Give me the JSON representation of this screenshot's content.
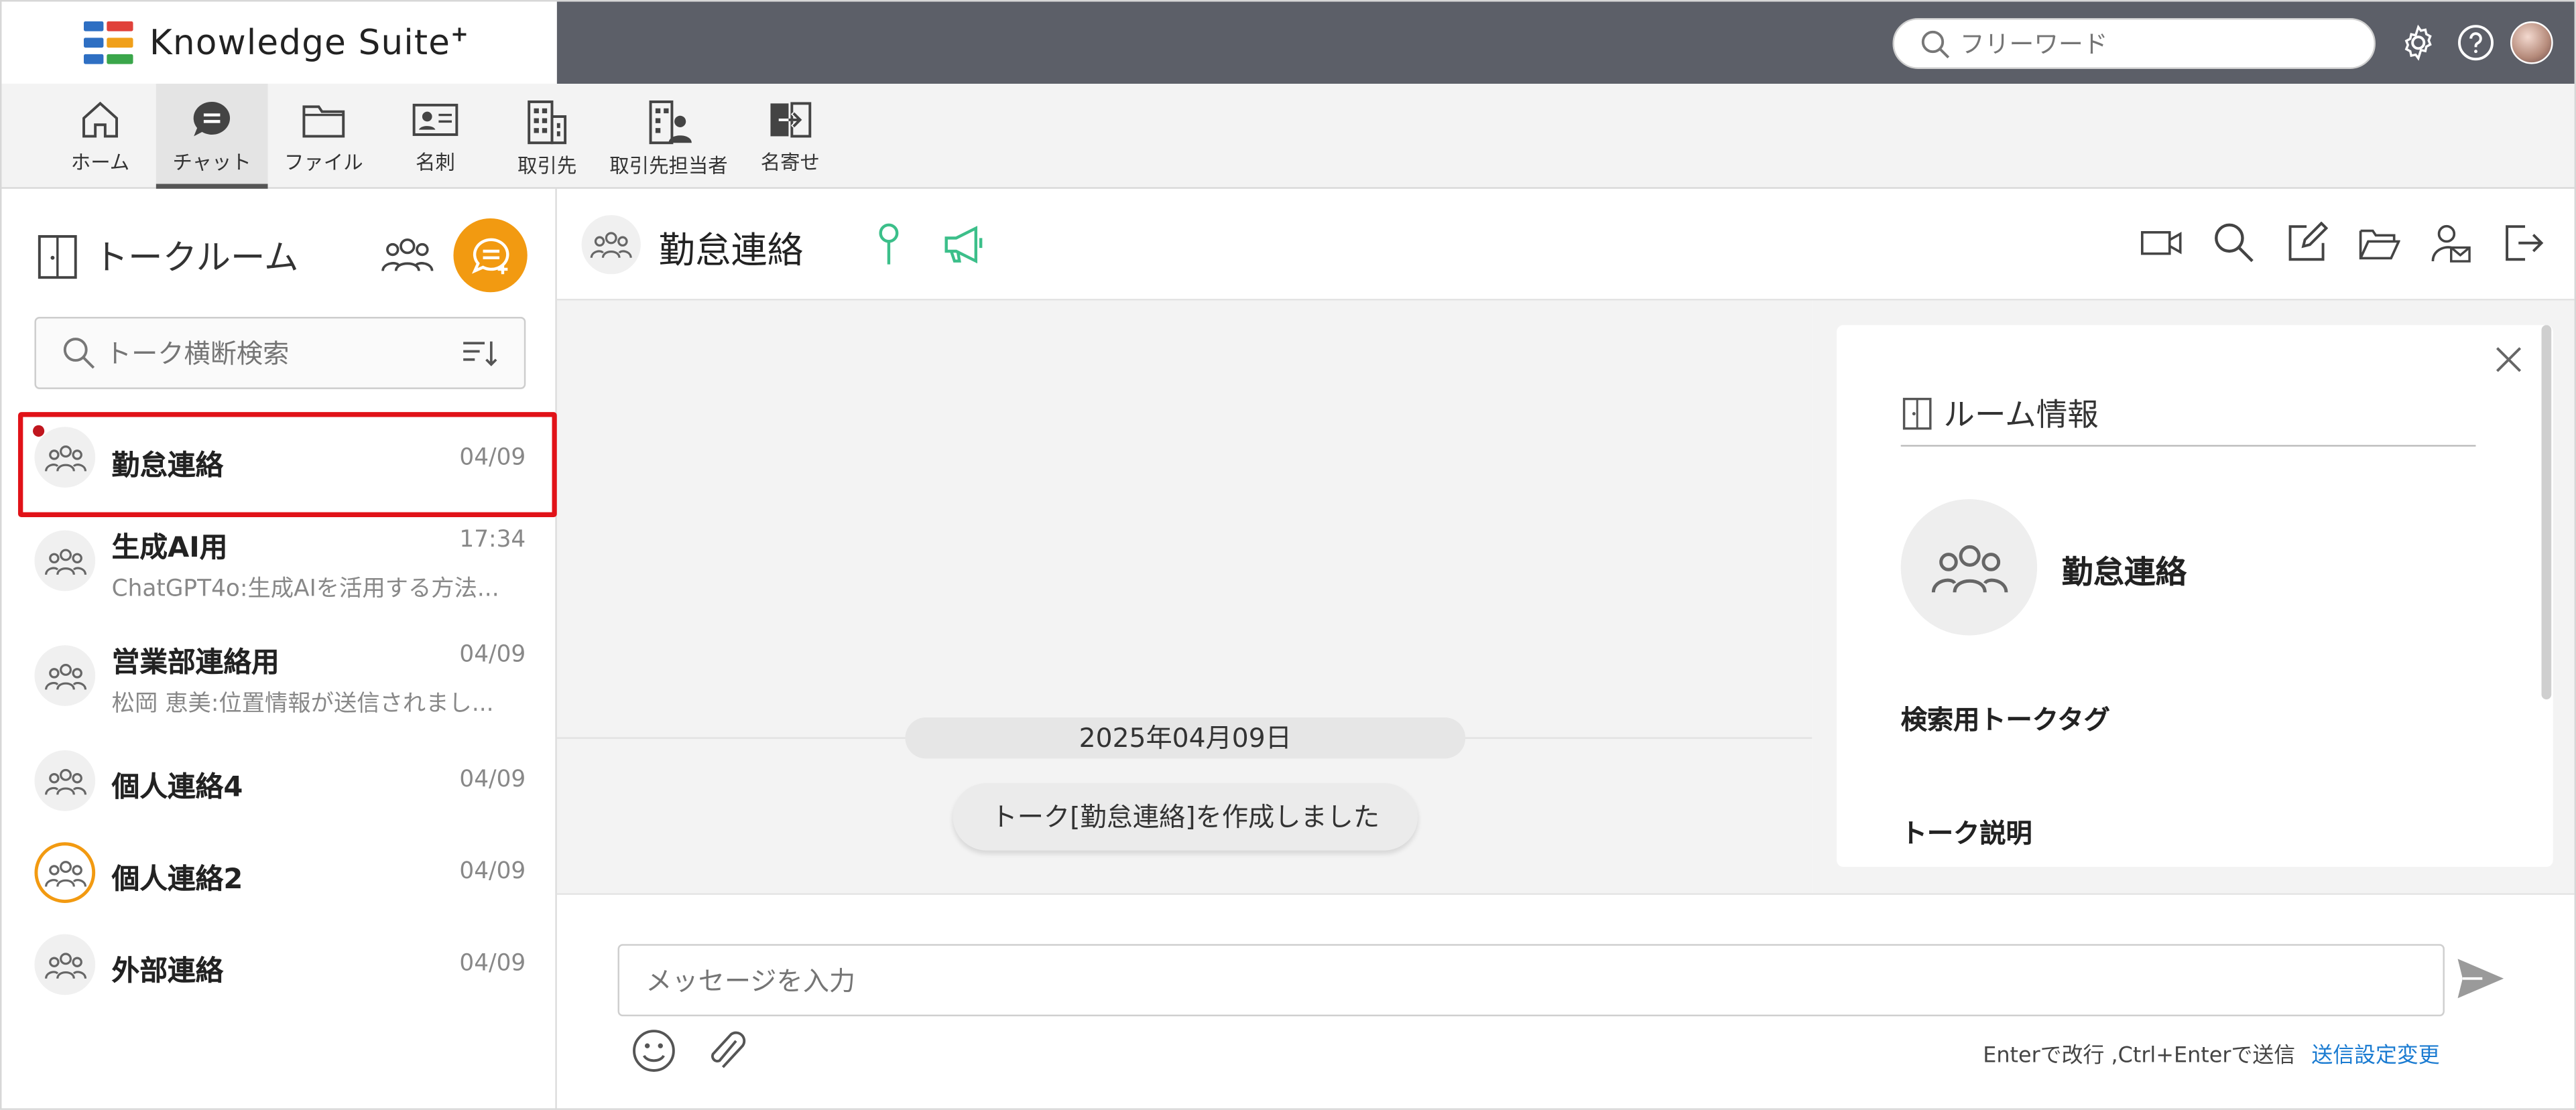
{
  "app": {
    "brand_name": "Knowledge Suite",
    "brand_plus": "+",
    "search_placeholder": "フリーワード",
    "accent_color": "#f29a11",
    "highlight_color": "#e11218"
  },
  "nav": {
    "items": [
      {
        "label": "ホーム",
        "icon": "home-icon"
      },
      {
        "label": "チャット",
        "icon": "chat-icon",
        "active": true
      },
      {
        "label": "ファイル",
        "icon": "folder-icon"
      },
      {
        "label": "名刺",
        "icon": "business-card-icon"
      },
      {
        "label": "取引先",
        "icon": "building-icon"
      },
      {
        "label": "取引先担当者",
        "icon": "building-person-icon"
      },
      {
        "label": "名寄せ",
        "icon": "merge-icon"
      }
    ]
  },
  "sidebar": {
    "title": "トークルーム",
    "search_placeholder": "トーク横断検索",
    "talks": [
      {
        "name": "勤怠連絡",
        "date": "04/09",
        "preview": "",
        "unread": true,
        "selected": true
      },
      {
        "name": "生成AI用",
        "date": "17:34",
        "preview": "ChatGPT4o:生成AIを活用する方法..."
      },
      {
        "name": "営業部連絡用",
        "date": "04/09",
        "preview": "松岡 恵美:位置情報が送信されまし..."
      },
      {
        "name": "個人連絡4",
        "date": "04/09",
        "preview": ""
      },
      {
        "name": "個人連絡2",
        "date": "04/09",
        "preview": "",
        "ring": true
      },
      {
        "name": "外部連絡",
        "date": "04/09",
        "preview": ""
      }
    ]
  },
  "chat": {
    "room_title": "勤怠連絡",
    "date_label": "2025年04月09日",
    "system_message": "トーク[勤怠連絡]を作成しました"
  },
  "room_info": {
    "title": "ルーム情報",
    "room_name": "勤怠連絡",
    "tags_label": "検索用トークタグ",
    "description_label": "トーク説明"
  },
  "composer": {
    "placeholder": "メッセージを入力",
    "hint": "Enterで改行 ,Ctrl+Enterで送信",
    "settings_link": "送信設定変更"
  }
}
